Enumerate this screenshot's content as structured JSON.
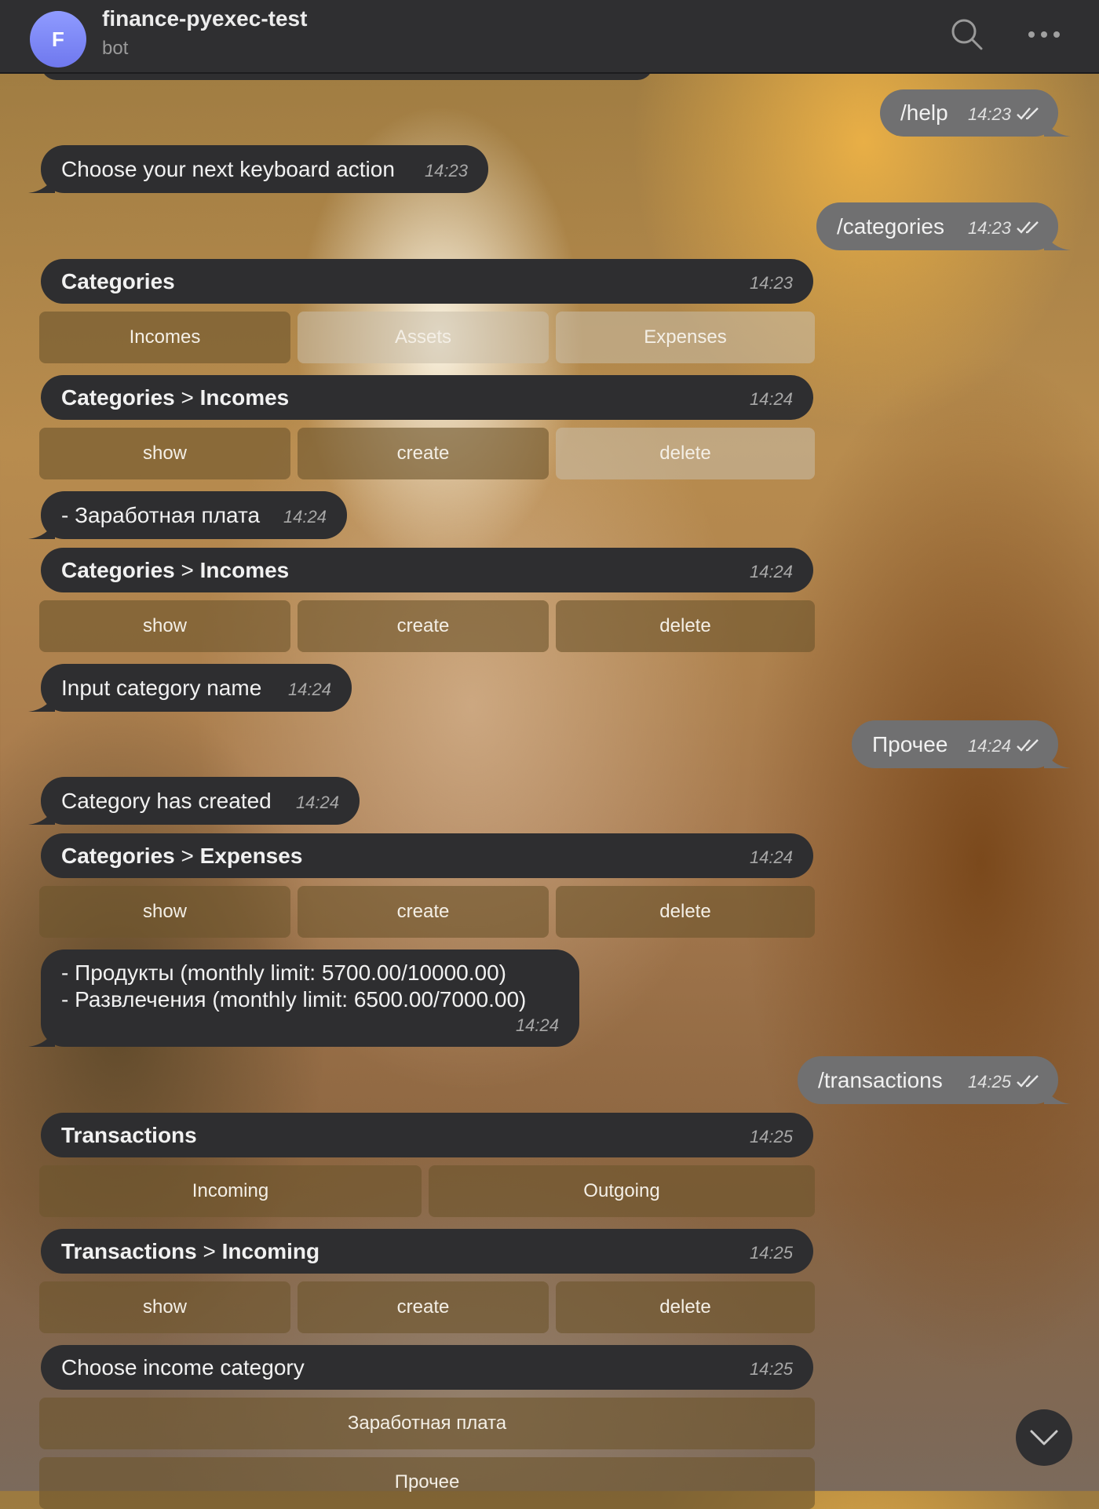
{
  "header": {
    "avatar_letter": "F",
    "chat_name": "finance-pyexec-test",
    "chat_subtitle": "bot",
    "search_icon": "search-icon",
    "more_icon": "more-horizontal-icon"
  },
  "messages": {
    "m1": {
      "text": "/help",
      "time": "14:23"
    },
    "m2": {
      "text": "Choose your next keyboard action",
      "time": "14:23"
    },
    "m3": {
      "text": "/categories",
      "time": "14:23"
    },
    "m4": {
      "title": "Categories",
      "time": "14:23",
      "buttons": [
        "Incomes",
        "Assets",
        "Expenses"
      ]
    },
    "m5": {
      "title_a": "Categories",
      "sep": ">",
      "title_b": "Incomes",
      "time": "14:24",
      "buttons": [
        "show",
        "create",
        "delete"
      ]
    },
    "m6": {
      "text": "- Заработная плата",
      "time": "14:24"
    },
    "m7": {
      "title_a": "Categories",
      "sep": ">",
      "title_b": "Incomes",
      "time": "14:24",
      "buttons": [
        "show",
        "create",
        "delete"
      ]
    },
    "m8": {
      "text": "Input category name",
      "time": "14:24"
    },
    "m9": {
      "text": "Прочее",
      "time": "14:24"
    },
    "m10": {
      "text": "Category has created",
      "time": "14:24"
    },
    "m11": {
      "title_a": "Categories",
      "sep": ">",
      "title_b": "Expenses",
      "time": "14:24",
      "buttons": [
        "show",
        "create",
        "delete"
      ]
    },
    "m12": {
      "lines": [
        "- Продукты (monthly limit: 5700.00/10000.00)",
        "- Развлечения (monthly limit: 6500.00/7000.00)"
      ],
      "time": "14:24"
    },
    "m13": {
      "text": "/transactions",
      "time": "14:25"
    },
    "m14": {
      "title": "Transactions",
      "time": "14:25",
      "buttons": [
        "Incoming",
        "Outgoing"
      ]
    },
    "m15": {
      "title_a": "Transactions",
      "sep": ">",
      "title_b": "Incoming",
      "time": "14:25",
      "buttons": [
        "show",
        "create",
        "delete"
      ]
    },
    "m16": {
      "text": "Choose income category",
      "time": "14:25",
      "buttons": [
        "Заработная плата",
        "Прочее"
      ]
    }
  },
  "scroll_down_icon": "chevron-down-icon",
  "colors": {
    "header_bg": "#2f2f31",
    "incoming_bubble": "#2e2e30",
    "outgoing_bubble": "#707071",
    "avatar": "#7b84f5"
  }
}
